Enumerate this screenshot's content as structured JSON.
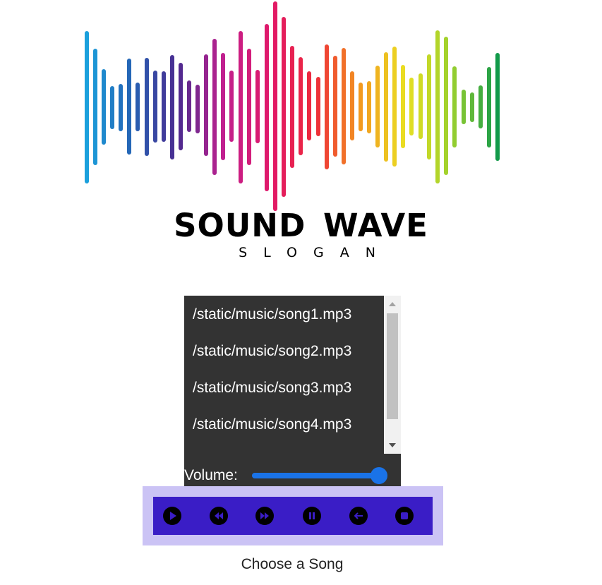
{
  "logo": {
    "title": "SOUND  WAVE",
    "slogan": "SLOGAN",
    "bar_gradient": [
      "#1ba0dc",
      "#2563b5",
      "#4c2a8f",
      "#c0208f",
      "#e0186a",
      "#ee2a3a",
      "#f39a1f",
      "#e9e022",
      "#9ad02e",
      "#129a4a"
    ],
    "icon": "sound-wave-icon"
  },
  "playlist": {
    "songs": [
      "/static/music/song1.mp3",
      "/static/music/song2.mp3",
      "/static/music/song3.mp3",
      "/static/music/song4.mp3"
    ]
  },
  "volume": {
    "label": "Volume:",
    "level": 1.0,
    "accent": "#1a73e8"
  },
  "controls": {
    "buttons": [
      {
        "name": "play-button",
        "icon": "play-icon"
      },
      {
        "name": "rewind-button",
        "icon": "rewind-icon"
      },
      {
        "name": "fast-forward-button",
        "icon": "fast-forward-icon"
      },
      {
        "name": "pause-button",
        "icon": "pause-icon"
      },
      {
        "name": "back-button",
        "icon": "arrow-left-icon"
      },
      {
        "name": "stop-button",
        "icon": "stop-icon"
      }
    ],
    "bar_color": "#3a1dc6",
    "frame_color": "#cbc3f5"
  },
  "status": {
    "text": "Choose a Song"
  }
}
